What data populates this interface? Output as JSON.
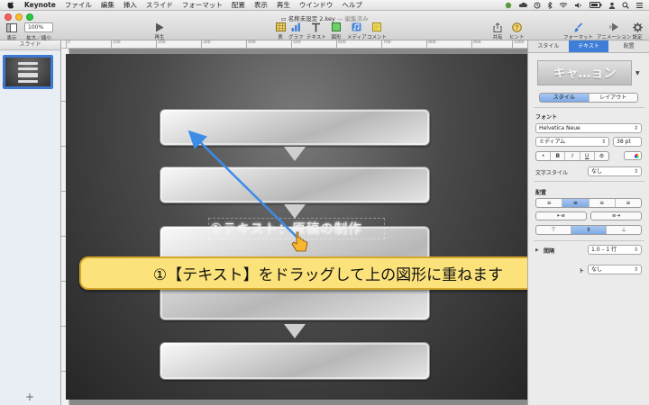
{
  "menubar": {
    "app": "Keynote",
    "items": [
      "ファイル",
      "編集",
      "挿入",
      "スライド",
      "フォーマット",
      "配置",
      "表示",
      "再生",
      "ウインドウ",
      "ヘルプ"
    ]
  },
  "window": {
    "title": "名称未設定 2.key",
    "edited": "— 編集済み"
  },
  "toolbar": {
    "view_label": "表示",
    "zoom_value": "100%",
    "zoom_label": "拡大／縮小",
    "play_label": "再生",
    "table_label": "表",
    "chart_label": "グラフ",
    "text_label": "テキスト",
    "shape_label": "図形",
    "media_label": "メディア",
    "comment_label": "コメント",
    "share_label": "共有",
    "tips_label": "ヒント",
    "format_label": "フォーマット",
    "animate_label": "アニメーション",
    "setup_label": "設定"
  },
  "navigator": {
    "header": "スライド",
    "slide_number": "1",
    "add_symbol": "+"
  },
  "ruler": {
    "top_ticks": [
      "0",
      "100",
      "200",
      "300",
      "400",
      "500",
      "600",
      "700",
      "800",
      "900",
      "1000"
    ],
    "left_ticks": [
      "100",
      "200",
      "300",
      "400",
      "500",
      "600",
      "700"
    ]
  },
  "slide": {
    "text": "①テキスト：原稿の制作"
  },
  "callout": {
    "text": "①【テキスト】をドラッグして上の図形に重ねます"
  },
  "inspector": {
    "tabs": [
      "スタイル",
      "テキスト",
      "配置"
    ],
    "active_tab": "テキスト",
    "style_preview": "キャ…ョン",
    "sub_tabs": [
      "スタイル",
      "レイアウト"
    ],
    "font_section": "フォント",
    "font_family": "Helvetica Neue",
    "font_weight": "ミディアム",
    "font_size": "38 pt",
    "bold": "B",
    "italic": "I",
    "underline": "U",
    "char_style_label": "文字スタイル",
    "char_style_value": "なし",
    "align_section": "配置",
    "spacing_label": "間隔",
    "spacing_value": "1.0 – 1 行",
    "bullets_value": "なし",
    "bullets_label_fragment": "ト"
  },
  "colors": {
    "accent": "#3f7ed8",
    "callout_fill": "#fbe27a",
    "callout_border": "#d4a72c",
    "drag_arrow": "#3c8ce8"
  }
}
